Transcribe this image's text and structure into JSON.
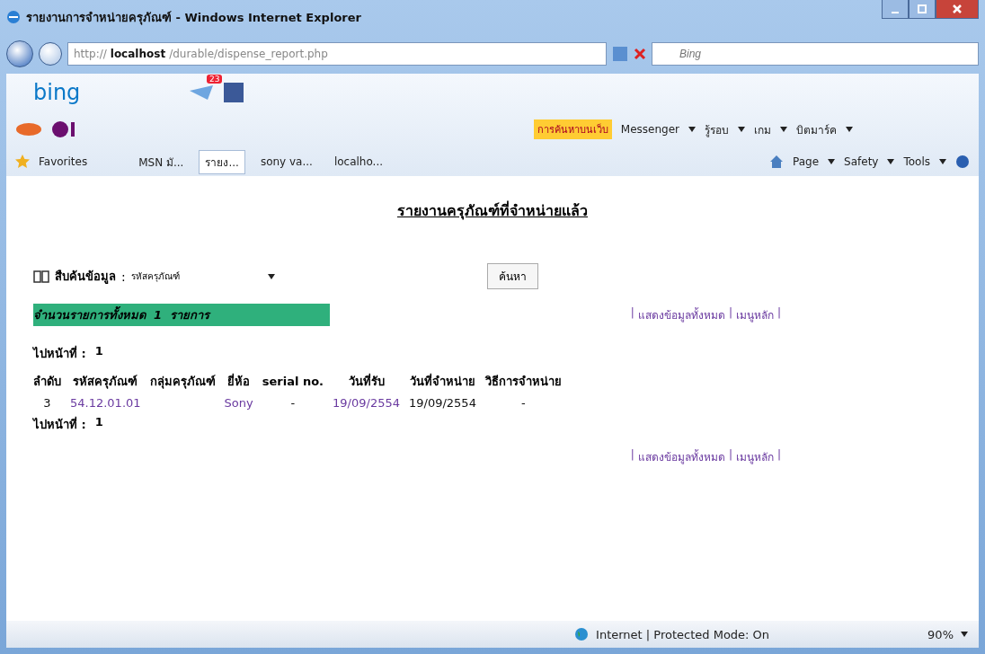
{
  "window": {
    "title": "รายงานการจำหน่ายครุภัณฑ์ - Windows Internet Explorer"
  },
  "address_bar": {
    "scheme": "http://",
    "host": "localhost",
    "path": "/durable/dispense_report.php"
  },
  "search_box": {
    "placeholder": "Bing"
  },
  "bing_toolbar": {
    "logo": "bing",
    "mail_count": "23"
  },
  "yahoo_toolbar": {
    "search_button": "การค้นหาบนเว็บ",
    "items": [
      "Messenger",
      "รู้รอบ",
      "เกม",
      "บิตมาร์ค"
    ]
  },
  "favorites_bar": {
    "label": "Favorites",
    "tabs": [
      {
        "label": "MSN มั...",
        "selected": false
      },
      {
        "label": "รายง...",
        "selected": true
      },
      {
        "label": "sony va...",
        "selected": false
      },
      {
        "label": "localho...",
        "selected": false
      }
    ],
    "commands": [
      "Page",
      "Safety",
      "Tools"
    ]
  },
  "page": {
    "heading": "รายงานครุภัณฑ์ที่จำหน่ายแล้ว",
    "search": {
      "label": "สืบค้นข้อมูล",
      "colon": ":",
      "field": "รหัสครุภัณฑ์",
      "button": "ค้นหา"
    },
    "total_banner": "จำนวนรายการทั้งหมด  1  รายการ",
    "links_top": {
      "separator": "|",
      "items": [
        "แสดงข้อมูลทั้งหมด",
        "เมนูหลัก"
      ]
    },
    "paging_top": {
      "label": "ไปหน้าที่ :",
      "page": "1"
    },
    "table": {
      "columns": [
        "ลำดับ",
        "รหัสครุภัณฑ์",
        "กลุ่มครุภัณฑ์",
        "ยี่ห้อ",
        "serial no.",
        "วันที่รับ",
        "วันที่จำหน่าย",
        "วิธีการจำหน่าย"
      ],
      "rows": [
        [
          "3",
          "54.12.01.01",
          "",
          "Sony",
          "-",
          "19/09/2554",
          "19/09/2554",
          "-"
        ]
      ]
    },
    "paging_bottom": {
      "label": "ไปหน้าที่ :",
      "page": "1"
    },
    "links_bottom": {
      "separator": "|",
      "items": [
        "แสดงข้อมูลทั้งหมด",
        "เมนูหลัก"
      ]
    }
  },
  "status_bar": {
    "zone": "Internet | Protected Mode: On",
    "zoom": "90%"
  }
}
